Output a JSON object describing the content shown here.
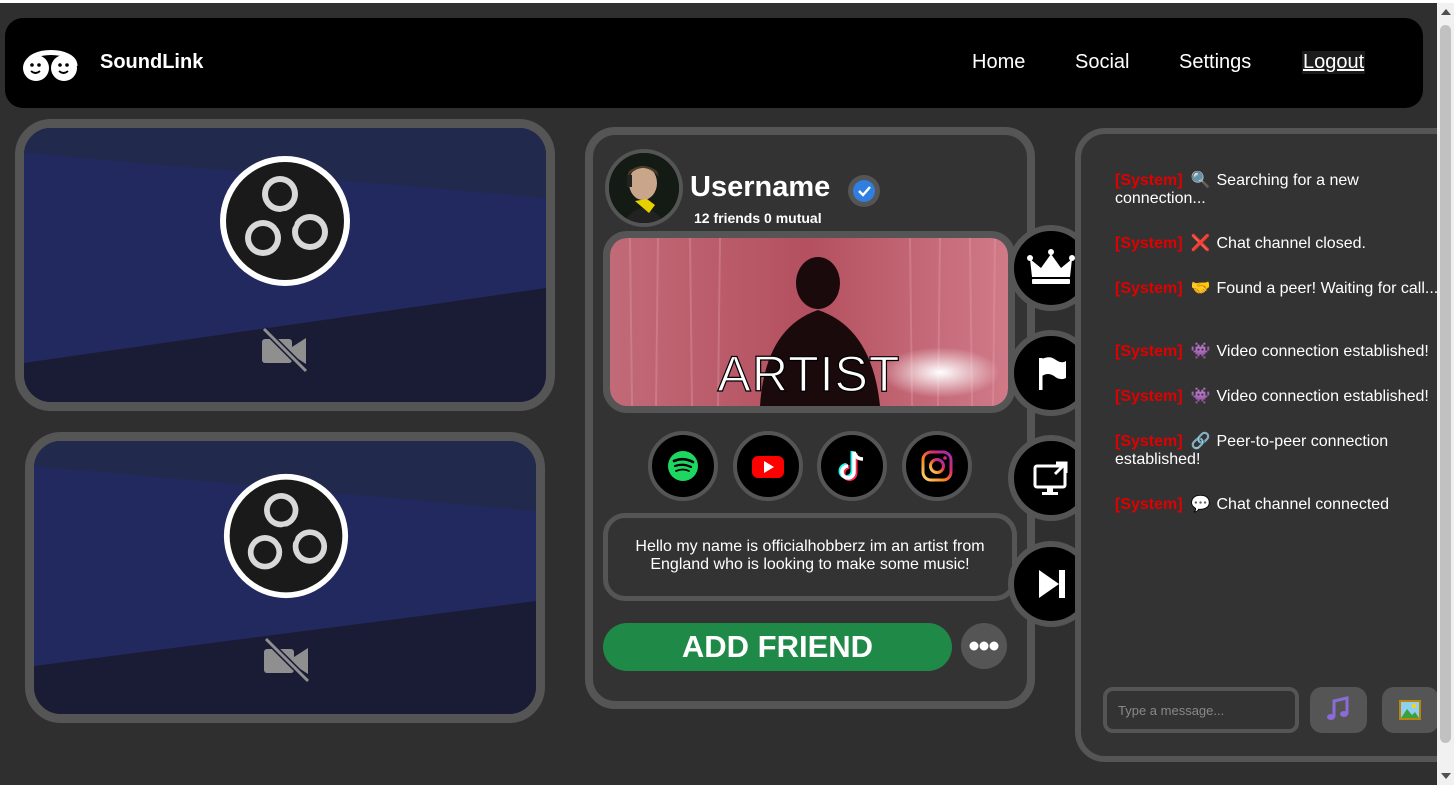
{
  "nav": {
    "brand": "SoundLink",
    "links": [
      "Home",
      "Social",
      "Settings",
      "Logout"
    ]
  },
  "profile": {
    "username": "Username",
    "friends_line": "12 friends 0 mutual",
    "banner_text": "ARTIST",
    "bio": "Hello my name is officialhobberz im an artist from England who is looking to make some music!",
    "add_friend": "ADD FRIEND",
    "socials": [
      "spotify-icon",
      "youtube-icon",
      "tiktok-icon",
      "instagram-icon"
    ]
  },
  "side_actions": [
    "crown-icon",
    "flag-icon",
    "screen-share-icon",
    "skip-icon"
  ],
  "chat": {
    "messages": [
      {
        "tag": "[System]",
        "emoji": "🔍",
        "text": "Searching for a new connection..."
      },
      {
        "tag": "[System]",
        "emoji": "❌",
        "text": "Chat channel closed."
      },
      {
        "tag": "[System]",
        "emoji": "🤝",
        "text": "Found a peer! Waiting for call..."
      },
      {
        "tag": "[System]",
        "emoji": "👾",
        "text": "Video connection established!"
      },
      {
        "tag": "[System]",
        "emoji": "👾",
        "text": "Video connection established!"
      },
      {
        "tag": "[System]",
        "emoji": "🔗",
        "text": "Peer-to-peer connection established!"
      },
      {
        "tag": "[System]",
        "emoji": "💬",
        "text": "Chat channel connected"
      }
    ],
    "input_placeholder": "Type a message..."
  },
  "colors": {
    "background": "#2f2f2f",
    "border": "#555555",
    "add_friend": "#1f8a47",
    "system_tag": "#e00000",
    "verified": "#2f7fe0"
  }
}
